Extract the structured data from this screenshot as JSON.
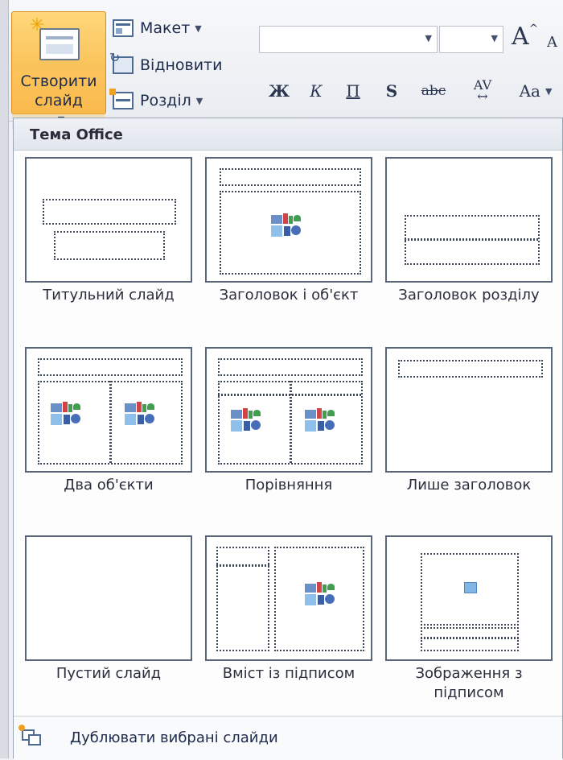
{
  "ribbon": {
    "new_slide_label_line1": "Створити",
    "new_slide_label_line2": "слайд",
    "layout_label": "Макет",
    "reset_label": "Відновити",
    "section_label": "Розділ",
    "grow_font": "A",
    "grow_font_sup": "^",
    "shrink_font": "A",
    "bold": "Ж",
    "italic": "К",
    "underline": "П",
    "shadow": "S",
    "strikethrough": "abc",
    "spacing": "AV",
    "change_case": "Aa"
  },
  "gallery": {
    "header": "Тема Office",
    "layouts": [
      {
        "label": "Титульний слайд"
      },
      {
        "label": "Заголовок і об'єкт"
      },
      {
        "label": "Заголовок розділу"
      },
      {
        "label": "Два об'єкти"
      },
      {
        "label": "Порівняння"
      },
      {
        "label": "Лише заголовок"
      },
      {
        "label": "Пустий слайд"
      },
      {
        "label": "Вміст із підписом"
      },
      {
        "label": "Зображення з підписом"
      }
    ],
    "footer_label": "Дублювати вибрані слайди"
  },
  "colors": {
    "new_slide_bg": "#f6b23f",
    "border": "#5a6678"
  }
}
